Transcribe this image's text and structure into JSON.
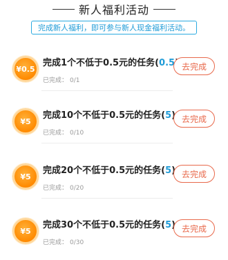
{
  "header": {
    "title": "新人福利活动",
    "notice": "完成新人福利，即可参与新人现金福利活动。"
  },
  "progress_label": "已完成：",
  "tasks": [
    {
      "reward": "¥0.5",
      "title": "完成1个不低于0.5元的任务(",
      "count": "0.5",
      "close": ")",
      "progress": "0/1",
      "button": "去完成"
    },
    {
      "reward": "¥5",
      "title": "完成10个不低于0.5元的任务(",
      "count": "5",
      "close": ")",
      "progress": "0/10",
      "button": "去完成"
    },
    {
      "reward": "¥5",
      "title": "完成20个不低于0.5元的任务(",
      "count": "5",
      "close": ")",
      "progress": "0/20",
      "button": "去完成"
    },
    {
      "reward": "¥5",
      "title": "完成30个不低于0.5元的任务(",
      "count": "5",
      "close": ")",
      "progress": "0/30",
      "button": "去完成"
    }
  ],
  "colors": {
    "accent": "#1e9bd7",
    "button": "#e8684a",
    "coin": "#ff8a00"
  }
}
